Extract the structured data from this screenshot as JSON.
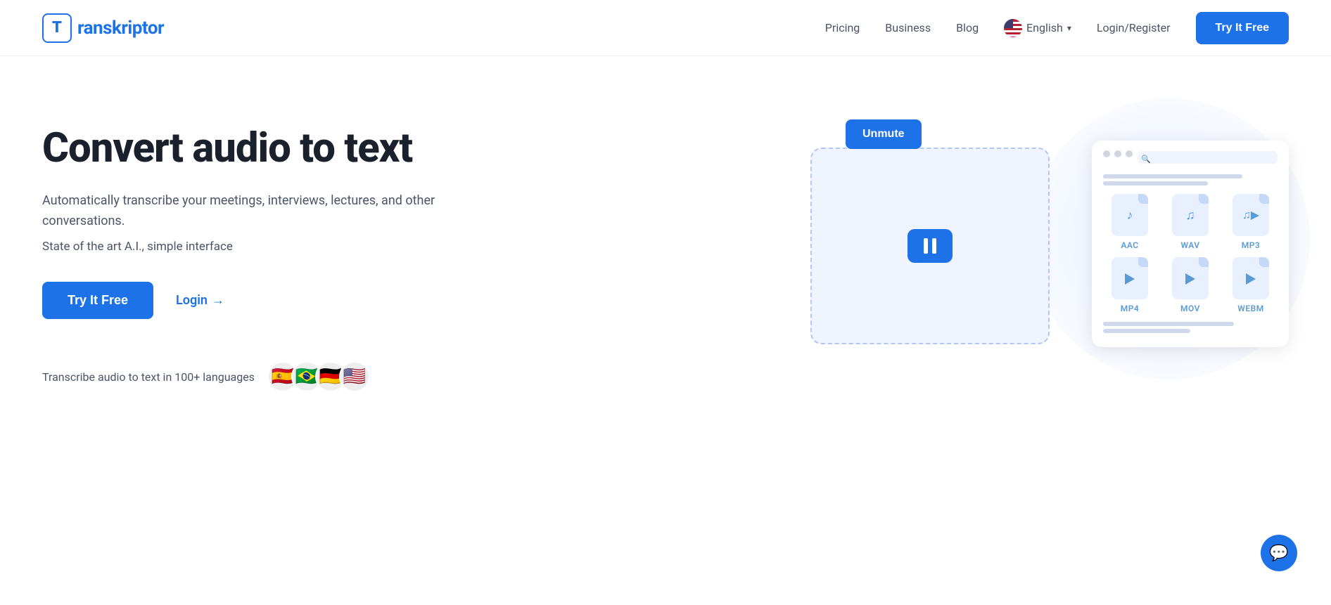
{
  "brand": {
    "logo_letter": "T",
    "logo_name": "ranskriptor",
    "full_name": "Transkriptor"
  },
  "navbar": {
    "pricing_label": "Pricing",
    "business_label": "Business",
    "blog_label": "Blog",
    "language_label": "English",
    "login_register_label": "Login/Register",
    "try_free_label": "Try It Free"
  },
  "hero": {
    "title": "Convert audio to text",
    "subtitle": "Automatically transcribe your meetings, interviews, lectures, and other conversations.",
    "subtext": "State of the art A.I., simple interface",
    "try_free_label": "Try It Free",
    "login_label": "Login",
    "login_arrow": "→",
    "languages_text": "Transcribe audio to text in 100+ languages",
    "flags": [
      "🇪🇸",
      "🇧🇷",
      "🇩🇪",
      "🇺🇸"
    ]
  },
  "illustration": {
    "unmute_label": "Unmute",
    "file_formats": [
      {
        "label": "AAC",
        "type": "audio"
      },
      {
        "label": "WAV",
        "type": "audio"
      },
      {
        "label": "MP3",
        "type": "audio"
      },
      {
        "label": "MP4",
        "type": "video"
      },
      {
        "label": "MOV",
        "type": "video"
      },
      {
        "label": "WEBM",
        "type": "video"
      }
    ]
  },
  "chat": {
    "icon": "💬"
  },
  "colors": {
    "primary": "#1d72e8",
    "text_dark": "#1a202c",
    "text_muted": "#4a5568"
  }
}
